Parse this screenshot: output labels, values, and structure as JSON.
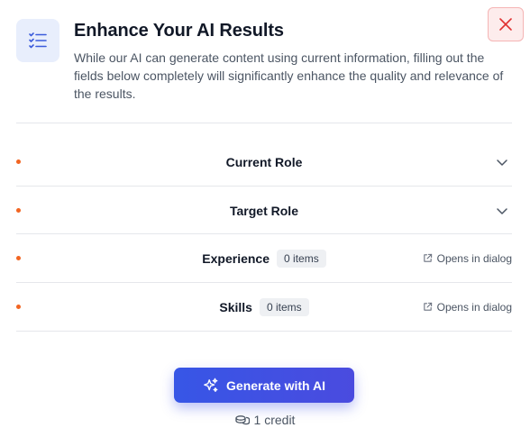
{
  "header": {
    "title": "Enhance Your AI Results",
    "description": "While our AI can generate content using current information, filling out the fields below completely will significantly enhance the quality and relevance of the results.",
    "icon": "checklist-icon",
    "close_icon": "close-icon"
  },
  "fields": [
    {
      "label": "Current Role",
      "control": "chevron-down-icon"
    },
    {
      "label": "Target Role",
      "control": "chevron-down-icon"
    },
    {
      "label": "Experience",
      "badge": "0 items",
      "link": "Opens in dialog"
    },
    {
      "label": "Skills",
      "badge": "0 items",
      "link": "Opens in dialog"
    }
  ],
  "footer": {
    "generate_label": "Generate with AI",
    "credit_text": "1 credit",
    "credit_icon": "coins-icon"
  },
  "colors": {
    "accent": "#3b4fe4",
    "required_dot": "#f26522",
    "close_bg": "#fdecec",
    "close_stroke": "#e03131",
    "icon_bg": "#e8eefc"
  }
}
